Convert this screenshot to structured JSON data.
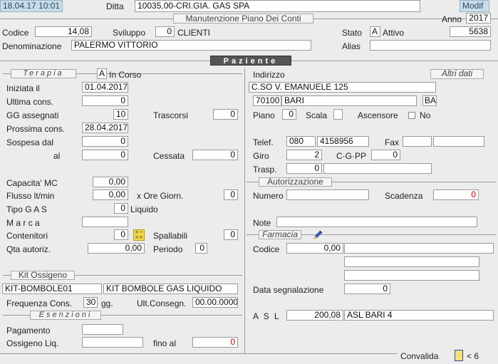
{
  "header": {
    "datetime": "18.04.17 10:01",
    "ditta_label": "Ditta",
    "ditta_value": "10035,00-CRI.GIA. GAS SPA",
    "mode_button": "Modif",
    "subtitle": "Manutenzione Piano Dei Conti",
    "anno_label": "Anno",
    "anno_value": "2017"
  },
  "account": {
    "codice_label": "Codice",
    "codice_value": "14,08",
    "sviluppo_label": "Sviluppo",
    "sviluppo_value": "0",
    "sviluppo_text": "CLIENTI",
    "stato_label": "Stato",
    "stato_value": "A",
    "stato_text": "Attivo",
    "stato_number": "5638",
    "denominazione_label": "Denominazione",
    "denominazione_value": "PALERMO VITTORIO",
    "alias_label": "Alias",
    "alias_value": ""
  },
  "section_title": "Paziente",
  "terapia": {
    "title": "Terapia",
    "status_code": "A",
    "status_text": "In Corso",
    "iniziata_label": "Iniziata  il",
    "iniziata_value": "01.04.2017",
    "ultima_label": "Ultima  cons.",
    "ultima_value": "0",
    "gg_label": "GG  assegnati",
    "gg_value": "10",
    "trascorsi_label": "Trascorsi",
    "trascorsi_value": "0",
    "prossima_label": "Prossima cons.",
    "prossima_value": "28.04.2017",
    "sospesa_label": "Sospesa  dal",
    "sospesa_value": "0",
    "al_label": "al",
    "al_value": "0",
    "cessata_label": "Cessata",
    "cessata_value": "0",
    "capacita_label": "Capacita'  MC",
    "capacita_value": "0,00",
    "flusso_label": "Flusso lt/min",
    "flusso_value": "0,00",
    "ore_label": "x  Ore Giorn.",
    "ore_value": "0",
    "tipo_label": "Tipo  G A S",
    "tipo_value": "0",
    "tipo_text": "Liquido",
    "marca_label": "M a r c a",
    "marca_value": "",
    "contenitori_label": "Contenitori",
    "contenitori_value": "0",
    "spallabili_label": "Spallabili",
    "spallabili_value": "0",
    "qta_label": "Qta autoriz.",
    "qta_value": "0,00",
    "periodo_label": "Periodo",
    "periodo_value": "0"
  },
  "kit": {
    "title": "Kit Ossigeno",
    "code": "KIT-BOMBOLE01",
    "description": "KIT BOMBOLE GAS LIQUIDO",
    "frequenza_label": "Frequenza Cons.",
    "frequenza_value": "30",
    "frequenza_unit": "gg.",
    "ult_label": "Ult.Consegn.",
    "ult_value": "00.00.0000"
  },
  "esenzioni": {
    "title": "Esenzioni",
    "pagamento_label": "Pagamento",
    "pagamento_value": "",
    "ossigeno_label": "Ossigeno Liq.",
    "ossigeno_value": "",
    "fino_label": "fino al",
    "fino_value": "0"
  },
  "indirizzo": {
    "label": "Indirizzo",
    "altri_dati_button": "Altri dati",
    "street": "C.SO V. EMANUELE 125",
    "cap": "70100",
    "city": "BARI",
    "province": "BA",
    "piano_label": "Piano",
    "piano_value": "0",
    "scala_label": "Scala",
    "scala_value": "",
    "ascensore_label": "Ascensore",
    "ascensore_text": "No",
    "telef_label": "Telef.",
    "telef_prefix": "080",
    "telef_number": "4158956",
    "fax_label": "Fax",
    "giro_label": "Giro",
    "giro_value": "2",
    "cgpp_label": "C·G·PP",
    "cgpp_value": "0",
    "trasp_label": "Trasp.",
    "trasp_value": "0"
  },
  "autorizzazione": {
    "title": "Autorizzazione",
    "numero_label": "Numero",
    "scadenza_label": "Scadenza",
    "scadenza_value": "0",
    "note_label": "Note"
  },
  "farmacia": {
    "title": "Farmacia",
    "codice_label": "Codice",
    "codice_value": "0,00",
    "data_label": "Data segnalazione",
    "data_value": "0",
    "asl_label": "A S L",
    "asl_value": "200,08",
    "asl_name": "ASL BARI 4"
  },
  "footer": {
    "convalida_label": "Convalida",
    "page_indicator": "< 6"
  }
}
